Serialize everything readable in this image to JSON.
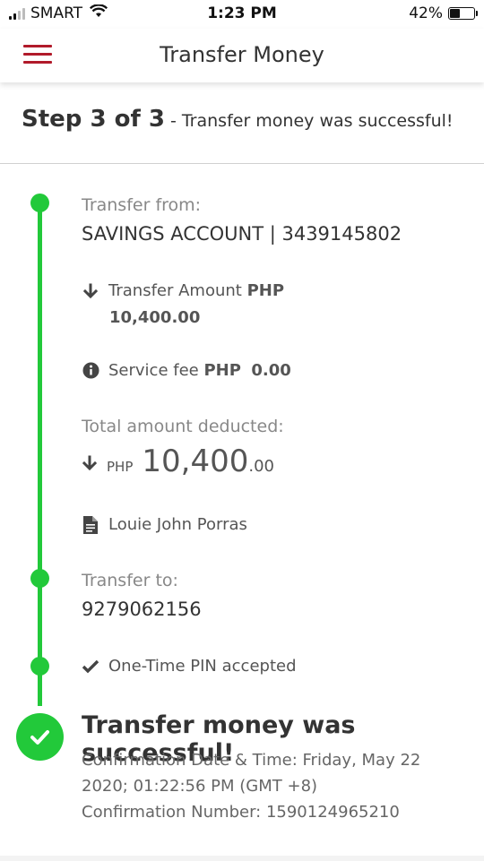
{
  "status_bar": {
    "carrier": "SMART",
    "time": "1:23 PM",
    "battery": "42%",
    "battery_level": 0.42
  },
  "header": {
    "title": "Transfer Money"
  },
  "step": {
    "label": "Step 3 of 3",
    "message": " - Transfer money was successful!"
  },
  "transfer_from": {
    "label": "Transfer from:",
    "account": "SAVINGS ACCOUNT | 3439145802"
  },
  "transfer_amount": {
    "label": "Transfer Amount",
    "currency": "PHP",
    "amount": "10,400.00"
  },
  "service_fee": {
    "label": "Service fee",
    "currency": "PHP",
    "amount": "0.00"
  },
  "total": {
    "label": "Total amount deducted:",
    "currency": "PHP",
    "whole": "10,400",
    "decimal": ".00"
  },
  "payee_name": "Louie John Porras",
  "transfer_to": {
    "label": "Transfer to:",
    "account": "9279062156"
  },
  "otp": {
    "label": "One-Time PIN accepted"
  },
  "success": {
    "title": "Transfer money was successful!",
    "datetime_line1": "Confirmation Date & Time: Friday, May 22",
    "datetime_line2": "2020; 01:22:56 PM (GMT +8)",
    "number_line": "Confirmation Number: 1590124965210"
  },
  "colors": {
    "brand_red": "#b11a2a",
    "timeline_green": "#22c93a"
  },
  "icons": {
    "menu": "hamburger-icon",
    "amount": "arrow-down-icon",
    "fee": "info-icon",
    "total": "arrow-down-icon",
    "payee": "document-icon",
    "otp": "check-icon",
    "success": "check-circle-icon"
  }
}
